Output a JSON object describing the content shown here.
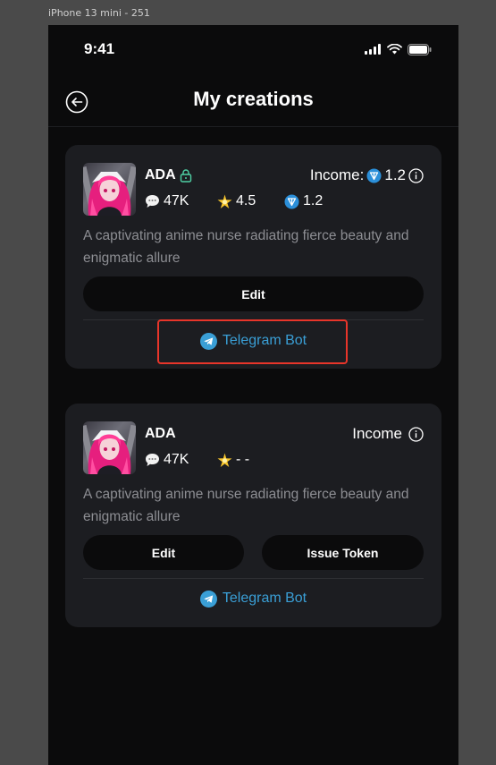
{
  "canvas_label": "iPhone 13 mini - 251",
  "status_bar": {
    "time": "9:41"
  },
  "header": {
    "title": "My creations"
  },
  "cards": [
    {
      "name": "ADA",
      "locked": true,
      "income_label": "Income:",
      "income_value": "1.2",
      "messages": "47K",
      "rating": "4.5",
      "token_value": "1.2",
      "description": "A captivating anime nurse radiating fierce beauty and enigmatic allure",
      "edit_label": "Edit",
      "telegram_label": "Telegram Bot"
    },
    {
      "name": "ADA",
      "income_label": "Income",
      "messages": "47K",
      "rating": "- -",
      "description": "A captivating anime nurse radiating fierce beauty and enigmatic allure",
      "edit_label": "Edit",
      "issue_token_label": "Issue Token",
      "telegram_label": "Telegram Bot"
    }
  ],
  "colors": {
    "background": "#0b0b0c",
    "card": "#1c1d21",
    "telegram": "#3a9fd6",
    "token": "#2b8fd9",
    "lock": "#4fd1a5",
    "highlight": "#e8352a"
  },
  "icons": [
    "back-arrow-icon",
    "lock-icon",
    "chat-icon",
    "star-icon",
    "token-icon",
    "info-icon",
    "telegram-icon",
    "signal-icon",
    "wifi-icon",
    "battery-icon"
  ]
}
